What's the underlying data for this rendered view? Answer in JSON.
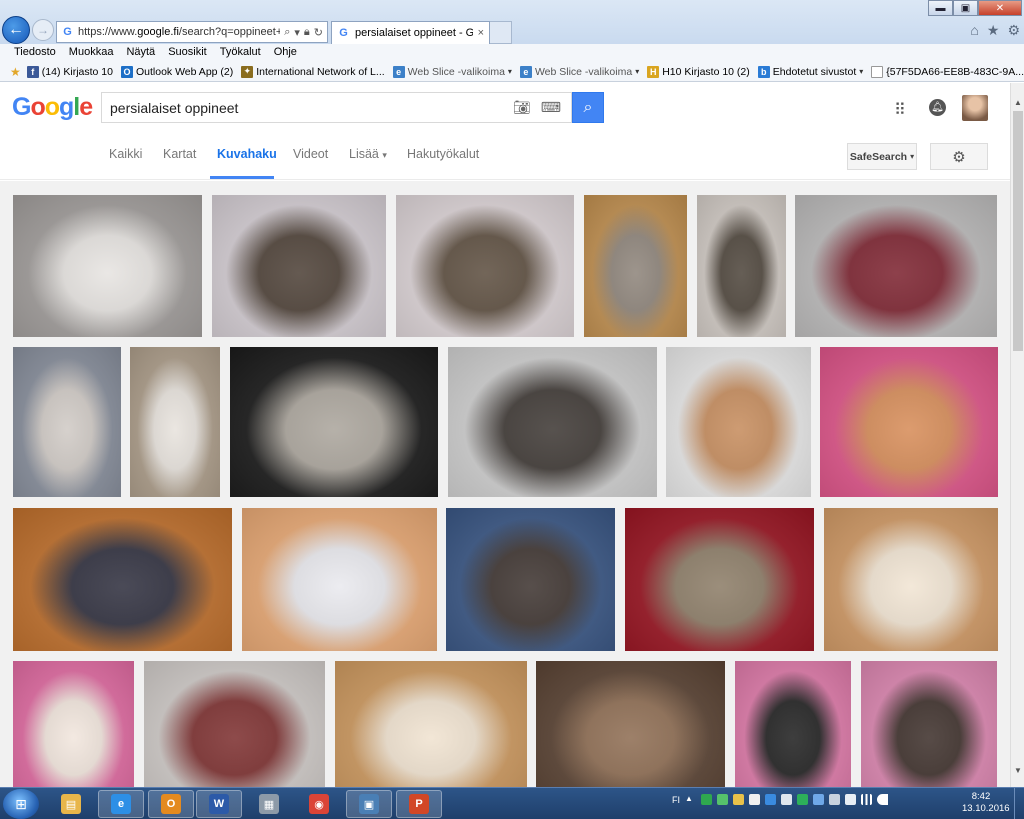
{
  "browser": {
    "address": {
      "url_prefix": "https://www.",
      "url_domain": "google.fi",
      "url_suffix": "/search?q=oppineet+pe"
    },
    "tab": {
      "title": "persialaiset oppineet - Goo...",
      "close": "×"
    },
    "window_controls": {
      "minimize": "▬",
      "maximize": "▣",
      "close": "✕"
    },
    "right_icons": {
      "home": "⌂",
      "favorites": "★",
      "tools": "⚙"
    }
  },
  "menubar": [
    "Tiedosto",
    "Muokkaa",
    "Näytä",
    "Suosikit",
    "Työkalut",
    "Ohje"
  ],
  "favorites_bar": [
    {
      "label": "(14) Kirjasto 10",
      "icon": "facebook-icon",
      "color": "#3b5998",
      "glyph": "f"
    },
    {
      "label": "Outlook Web App (2)",
      "icon": "outlook-icon",
      "color": "#1d6fc7",
      "glyph": "O"
    },
    {
      "label": "International Network of L...",
      "icon": "network-icon",
      "color": "#8a6d1f",
      "glyph": "✦"
    },
    {
      "label": "Web Slice -valikoima",
      "icon": "webslice-icon",
      "color": "#3c80c8",
      "glyph": "e",
      "dropdown": true,
      "gray": true
    },
    {
      "label": "Web Slice -valikoima",
      "icon": "webslice-icon",
      "color": "#3c80c8",
      "glyph": "e",
      "dropdown": true,
      "gray": true
    },
    {
      "label": "H10 Kirjasto 10 (2)",
      "icon": "h10-icon",
      "color": "#d9a520",
      "glyph": "H"
    },
    {
      "label": "Ehdotetut sivustot",
      "icon": "bing-icon",
      "color": "#2a7bd5",
      "glyph": "b",
      "dropdown": true
    },
    {
      "label": "{57F5DA66-EE8B-483C-9A...",
      "icon": "page-icon",
      "color": "#ffffff",
      "glyph": ""
    }
  ],
  "google": {
    "logo": {
      "g1": "G",
      "o1": "o",
      "o2": "o",
      "g2": "g",
      "l": "l",
      "e": "e"
    },
    "query": "persialaiset oppineet",
    "nav": {
      "all": "Kaikki",
      "maps": "Kartat",
      "images": "Kuvahaku",
      "videos": "Videot",
      "more": "Lisää",
      "more_arrow": "▾",
      "tools": "Hakutyökalut"
    },
    "safesearch": "SafeSearch",
    "safesearch_arrow": "▾"
  },
  "thumbnails": [
    {
      "color": "#a8a4a2",
      "accent": "#e6e3e0"
    },
    {
      "color": "#ddd6dc",
      "accent": "#4a3d33"
    },
    {
      "color": "#e6dde0",
      "accent": "#5a4b3c"
    },
    {
      "color": "#c79452",
      "accent": "#8c8278"
    },
    {
      "color": "#d9d2cc",
      "accent": "#4b4238"
    },
    {
      "color": "#c4c3c3",
      "accent": "#7a1f2c"
    },
    {
      "color": "#8d94a2",
      "accent": "#cfc9c4"
    },
    {
      "color": "#b3a38f",
      "accent": "#e7e2dc"
    },
    {
      "color": "#1c1c1c",
      "accent": "#a9a39a"
    },
    {
      "color": "#d8d8d8",
      "accent": "#3a3430"
    },
    {
      "color": "#f2f2f2",
      "accent": "#c58a5a"
    },
    {
      "color": "#e7588f",
      "accent": "#d68a55"
    },
    {
      "color": "#c7742e",
      "accent": "#2b2b3a"
    },
    {
      "color": "#f2b07a",
      "accent": "#e9e9ee"
    },
    {
      "color": "#3c5a8a",
      "accent": "#3a302c"
    },
    {
      "color": "#a01624",
      "accent": "#8a7a64"
    },
    {
      "color": "#d9a06a",
      "accent": "#f1e4d2"
    },
    {
      "color": "#e96fa8",
      "accent": "#f1e5dc"
    },
    {
      "color": "#d8d3d0",
      "accent": "#7a2b2b"
    },
    {
      "color": "#d6a064",
      "accent": "#f0e2cf"
    },
    {
      "color": "#5e4636",
      "accent": "#8c6a4f"
    },
    {
      "color": "#e77fb0",
      "accent": "#1c1c1c"
    },
    {
      "color": "#e58cb8",
      "accent": "#3a2c27"
    }
  ],
  "taskbar": {
    "start_glyph": "⊞",
    "apps": [
      {
        "name": "explorer",
        "glyph": "▤",
        "color": "#e8b64a",
        "pinned": false
      },
      {
        "name": "ie",
        "glyph": "e",
        "color": "#2d8fe6",
        "pinned": true
      },
      {
        "name": "outlook",
        "glyph": "O",
        "color": "#e48a1f",
        "pinned": true
      },
      {
        "name": "word",
        "glyph": "W",
        "color": "#2c5aa8",
        "pinned": true
      },
      {
        "name": "calculator",
        "glyph": "▦",
        "color": "#8d9aa8",
        "pinned": false
      },
      {
        "name": "chrome",
        "glyph": "◉",
        "color": "#db4437",
        "pinned": false
      },
      {
        "name": "network",
        "glyph": "▣",
        "color": "#4a7fb5",
        "pinned": true
      },
      {
        "name": "powerpoint",
        "glyph": "P",
        "color": "#d24726",
        "pinned": true
      }
    ],
    "lang": "FI",
    "clock": {
      "time": "8:42",
      "date": "13.10.2016"
    }
  }
}
